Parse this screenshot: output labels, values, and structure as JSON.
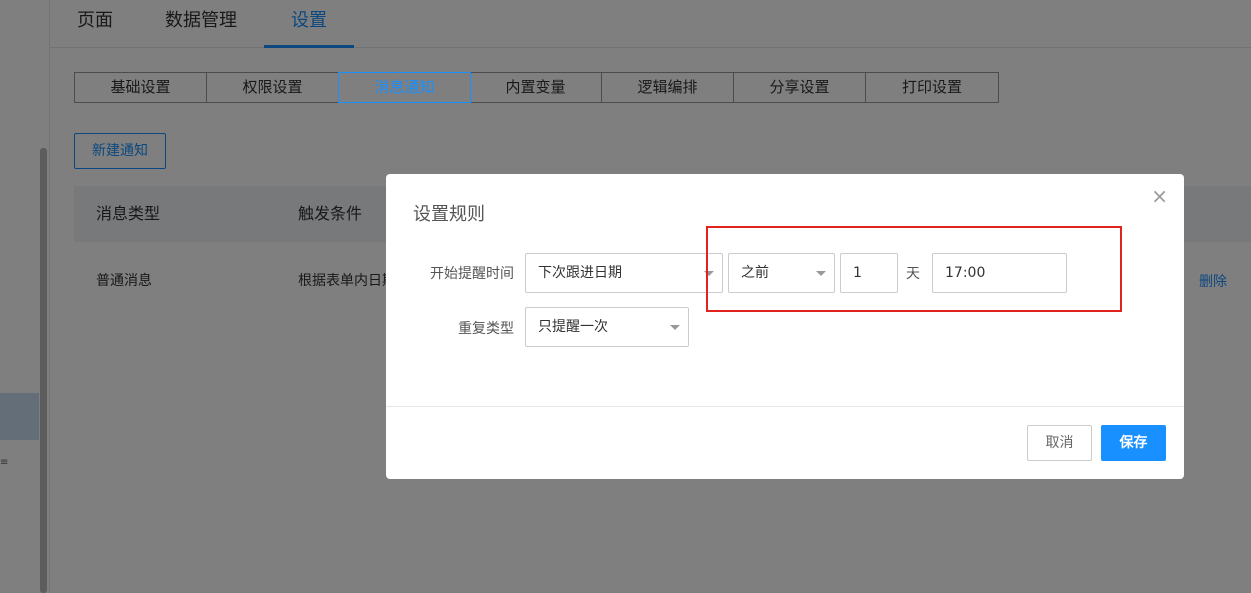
{
  "top_tabs": [
    "页面",
    "数据管理",
    "设置"
  ],
  "sub_tabs": [
    "基础设置",
    "权限设置",
    "消息通知",
    "内置变量",
    "逻辑编排",
    "分享设置",
    "打印设置"
  ],
  "new_button": "新建通知",
  "table": {
    "headers": [
      "消息类型",
      "触发条件"
    ],
    "rows": [
      [
        "普通消息",
        "根据表单内日期"
      ]
    ],
    "delete_label": "删除"
  },
  "modal": {
    "title": "设置规则",
    "start_label": "开始提醒时间",
    "date_field": "下次跟进日期",
    "relation": "之前",
    "days": "1",
    "day_unit": "天",
    "time": "17:00",
    "repeat_label": "重复类型",
    "repeat_value": "只提醒一次",
    "cancel": "取消",
    "save": "保存",
    "close_icon": "×"
  },
  "left_mark": "≡",
  "colors": {
    "primary": "#1890ff",
    "highlight": "#e0231d"
  }
}
